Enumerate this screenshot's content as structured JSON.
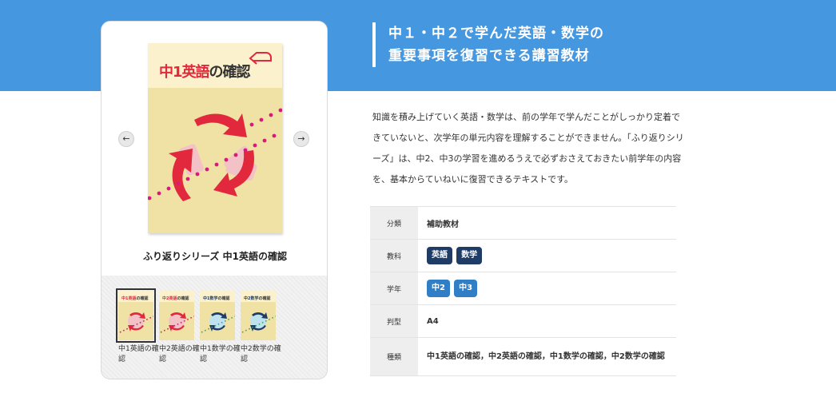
{
  "header": {
    "line1": "中１・中２で学んだ英語・数学の",
    "line2": "重要事項を復習できる講習教材"
  },
  "product": {
    "cover": {
      "title_red": "中1英語",
      "title_dark": "の確認"
    },
    "name": "ふり返りシリーズ 中1英語の確認",
    "prev_arrow": "←",
    "next_arrow": "→",
    "thumbnails": [
      {
        "title_red": "中1英語",
        "title_dark": "の確認",
        "label": "中1英語の確認",
        "color": "#e2283c"
      },
      {
        "title_red": "中2英語",
        "title_dark": "の確認",
        "label": "中2英語の確認",
        "color": "#e2283c"
      },
      {
        "title_red": "中1数学",
        "title_dark": "の確認",
        "label": "中1数学の確認",
        "color": "#1e3c66"
      },
      {
        "title_red": "中2数学",
        "title_dark": "の確認",
        "label": "中2数学の確認",
        "color": "#1e3c66"
      }
    ]
  },
  "description": "知識を積み上げていく英語・数学は、前の学年で学んだことがしっかり定着できていないと、次学年の単元内容を理解することができません。「ふり返りシリーズ」は、中2、中3の学習を進めるうえで必ずおさえておきたい前学年の内容を、基本からていねいに復習できるテキストです。",
  "specs": {
    "category_label": "分類",
    "category_value": "補助教材",
    "subject_label": "教科",
    "subjects": [
      "英語",
      "数学"
    ],
    "grade_label": "学年",
    "grades": [
      "中2",
      "中3"
    ],
    "size_label": "判型",
    "size_value": "A4",
    "kinds_label": "種類",
    "kinds_value": "中1英語の確認，中2英語の確認，中1数学の確認，中2数学の確認"
  },
  "colors": {
    "banner": "#4597e0",
    "tag_subject": "#1e3c66",
    "tag_grade": "#2f7ec6",
    "cover_bg": "#efe2a4",
    "accent_red": "#e2283c"
  }
}
